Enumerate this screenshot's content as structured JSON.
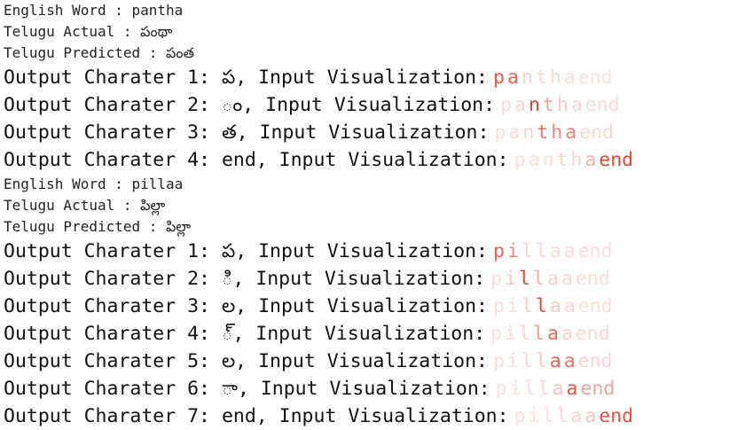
{
  "blocks": [
    {
      "english_label": "English Word : pantha",
      "actual_label": "Telugu Actual : పంథా",
      "predicted_label": "Telugu Predicted : పంత",
      "tokens": [
        "p",
        "a",
        "n",
        "t",
        "h",
        "a",
        "end"
      ],
      "rows": [
        {
          "text": "Output Charater 1: ప, Input Visualization:",
          "weights": [
            0.85,
            0.8,
            0.1,
            0.08,
            0.05,
            0.04,
            0.03
          ]
        },
        {
          "text": "Output Charater 2: ం, Input Visualization:",
          "weights": [
            0.05,
            0.08,
            0.95,
            0.4,
            0.15,
            0.08,
            0.05
          ]
        },
        {
          "text": "Output Charater 3: త, Input Visualization:",
          "weights": [
            0.03,
            0.04,
            0.1,
            0.7,
            0.55,
            0.6,
            0.08
          ]
        },
        {
          "text": "Output Charater 4: end, Input Visualization:",
          "weights": [
            0.03,
            0.03,
            0.04,
            0.08,
            0.1,
            0.3,
            0.95
          ]
        }
      ]
    },
    {
      "english_label": "English Word : pillaa",
      "actual_label": "Telugu Actual : పిల్లా",
      "predicted_label": "Telugu Predicted : పిల్లా",
      "tokens": [
        "p",
        "i",
        "l",
        "l",
        "a",
        "a",
        "end"
      ],
      "rows": [
        {
          "text": "Output Charater 1: ప, Input Visualization:",
          "weights": [
            0.75,
            0.55,
            0.1,
            0.08,
            0.06,
            0.05,
            0.04
          ]
        },
        {
          "text": "Output Charater 2: ి, Input Visualization:",
          "weights": [
            0.06,
            0.15,
            0.95,
            0.3,
            0.12,
            0.08,
            0.05
          ]
        },
        {
          "text": "Output Charater 3: ల, Input Visualization:",
          "weights": [
            0.04,
            0.05,
            0.12,
            0.97,
            0.15,
            0.08,
            0.05
          ]
        },
        {
          "text": "Output Charater 4: ్, Input Visualization:",
          "weights": [
            0.03,
            0.04,
            0.1,
            0.45,
            0.75,
            0.12,
            0.06
          ]
        },
        {
          "text": "Output Charater 5: ల, Input Visualization:",
          "weights": [
            0.03,
            0.04,
            0.06,
            0.15,
            0.8,
            0.7,
            0.1
          ]
        },
        {
          "text": "Output Charater 6: ా, Input Visualization:",
          "weights": [
            0.03,
            0.03,
            0.04,
            0.08,
            0.2,
            0.85,
            0.4
          ]
        },
        {
          "text": "Output Charater 7: end, Input Visualization:",
          "weights": [
            0.03,
            0.03,
            0.04,
            0.06,
            0.1,
            0.2,
            0.9
          ]
        }
      ]
    }
  ],
  "colors": {
    "attention_high": "#e0402a",
    "attention_base": "#fbe4df"
  }
}
